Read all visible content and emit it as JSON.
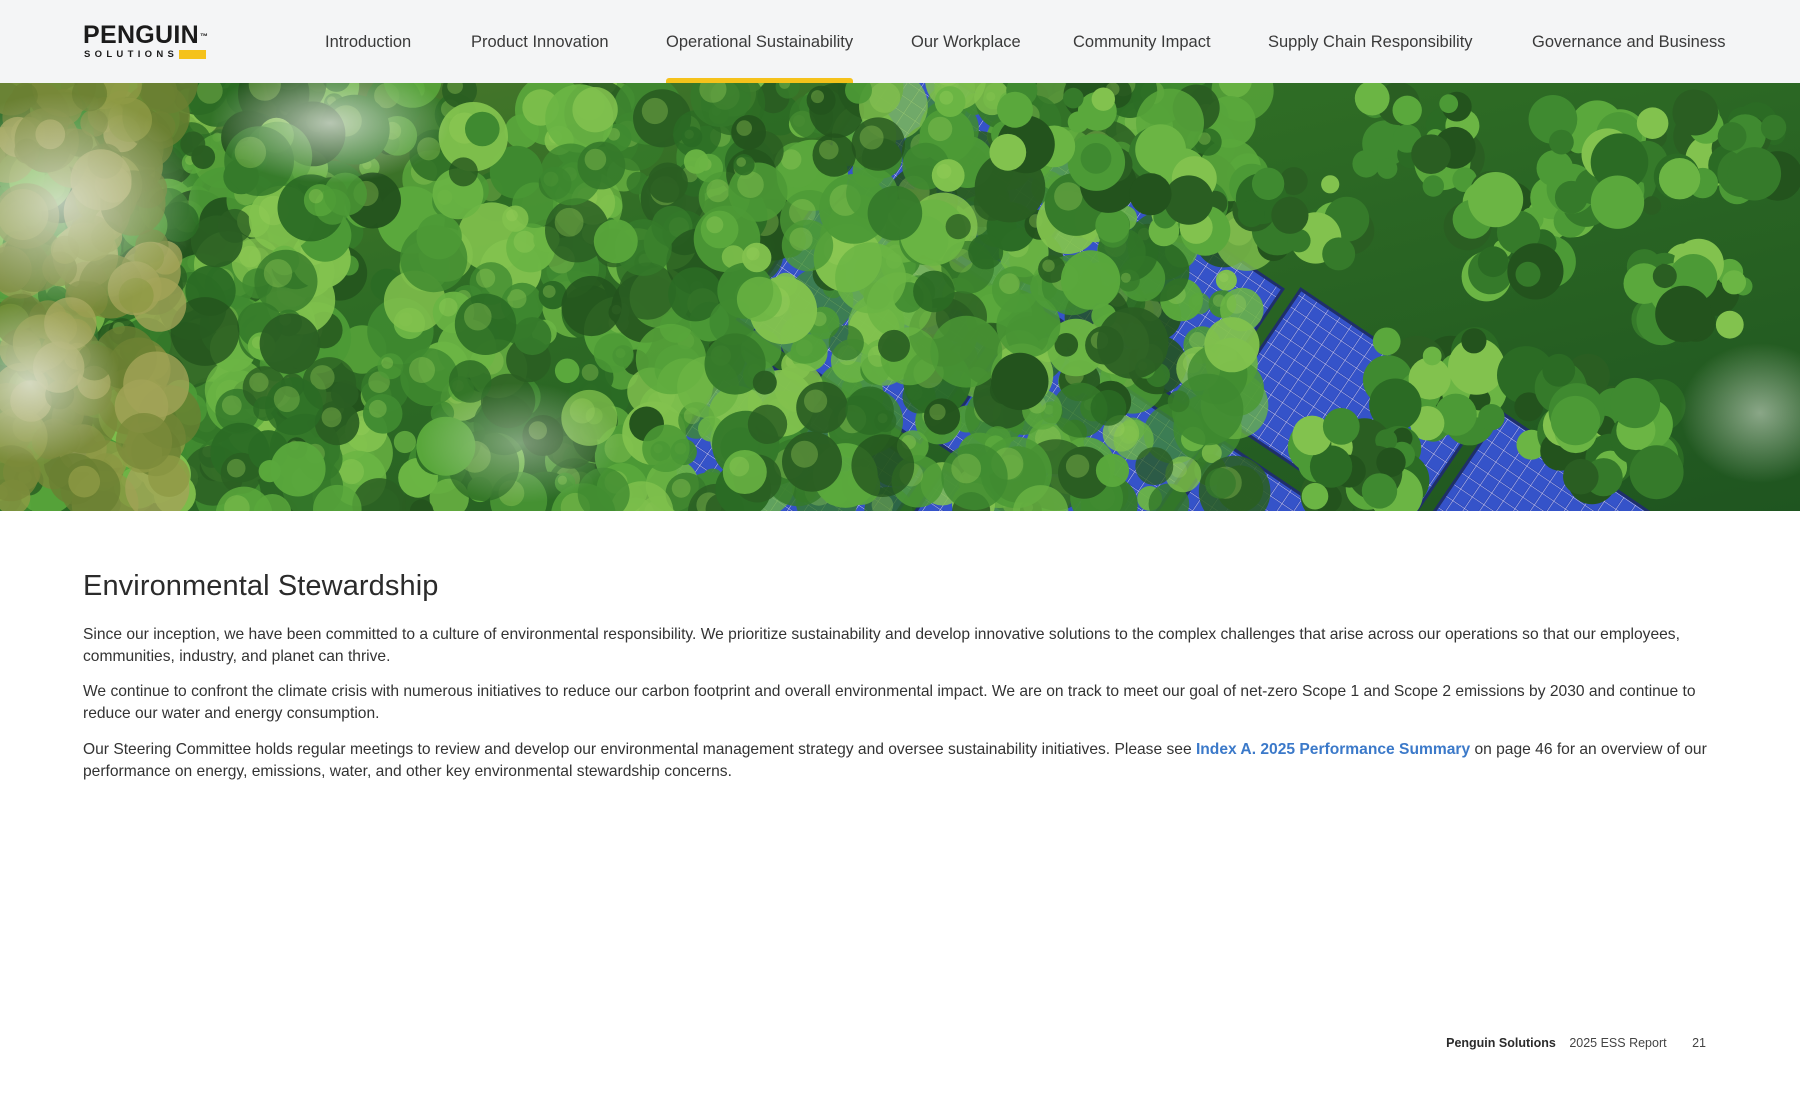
{
  "header": {
    "logo": {
      "word": "PENGUIN",
      "sub": "SOLUTIONS",
      "mark": "™"
    },
    "nav": [
      {
        "label": "Introduction",
        "active": false
      },
      {
        "label": "Product Innovation",
        "active": false
      },
      {
        "label": "Operational Sustainability",
        "active": true
      },
      {
        "label": "Our Workplace",
        "active": false
      },
      {
        "label": "Community Impact",
        "active": false
      },
      {
        "label": "Supply Chain Responsibility",
        "active": false
      },
      {
        "label": "Governance and Business",
        "active": false
      }
    ],
    "accent_color": "#f5c21b"
  },
  "hero": {
    "image": "aerial-forest-with-solar-panels"
  },
  "main": {
    "title": "Environmental Stewardship",
    "paragraphs": {
      "p1": "Since our inception, we have been committed to a culture of environmental responsibility. We prioritize sustainability and develop innovative solutions to the complex challenges that arise across our operations so that our employees, communities, industry, and planet can thrive.",
      "p2": "We continue to confront the climate crisis with numerous initiatives to reduce our carbon footprint and overall environmental impact. We are on track to meet our goal of net-zero Scope 1 and Scope 2 emissions by 2030 and continue to reduce our water and energy consumption.",
      "p3_before": "Our Steering Committee holds regular meetings to review and develop our environmental management strategy and oversee sustainability initiatives. Please see ",
      "p3_link": "Index A. 2025 Performance Summary",
      "p3_after": " on page 46 for an overview of our performance on energy, emissions, water, and other key environmental stewardship concerns."
    },
    "link_color": "#3b79c9"
  },
  "footer": {
    "brand": "Penguin Solutions",
    "report": "2025 ESS Report",
    "page": "21"
  }
}
